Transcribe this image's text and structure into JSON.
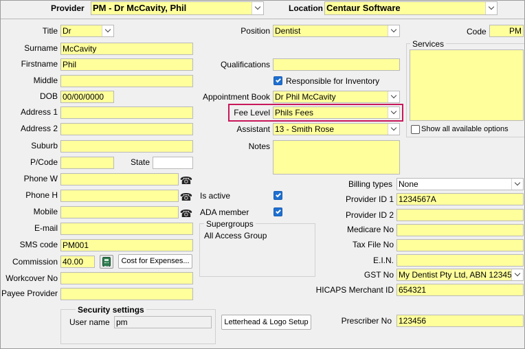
{
  "header": {
    "provider_label": "Provider",
    "provider_value": "PM - Dr McCavity, Phil",
    "location_label": "Location",
    "location_value": "Centaur Software"
  },
  "left": {
    "title_label": "Title",
    "title_value": "Dr",
    "surname_label": "Surname",
    "surname_value": "McCavity",
    "firstname_label": "Firstname",
    "firstname_value": "Phil",
    "middle_label": "Middle",
    "middle_value": "",
    "dob_label": "DOB",
    "dob_value": "00/00/0000",
    "address1_label": "Address 1",
    "address1_value": "",
    "address2_label": "Address 2",
    "address2_value": "",
    "suburb_label": "Suburb",
    "suburb_value": "",
    "pcode_label": "P/Code",
    "pcode_value": "",
    "state_label": "State",
    "state_value": "",
    "phonew_label": "Phone W",
    "phonew_value": "",
    "phoneh_label": "Phone H",
    "phoneh_value": "",
    "mobile_label": "Mobile",
    "mobile_value": "",
    "email_label": "E-mail",
    "email_value": "",
    "sms_label": "SMS code",
    "sms_value": "PM001",
    "commission_label": "Commission",
    "commission_value": "40.00",
    "cost_button": "Cost for Expenses...",
    "workcover_label": "Workcover No",
    "workcover_value": "",
    "payee_label": "Payee Provider",
    "payee_value": ""
  },
  "middle": {
    "position_label": "Position",
    "position_value": "Dentist",
    "qualifications_label": "Qualifications",
    "qualifications_value": "",
    "responsible_label": "Responsible for Inventory",
    "appt_label": "Appointment Book",
    "appt_value": "Dr Phil McCavity",
    "fee_label": "Fee Level",
    "fee_value": "Phils Fees",
    "assistant_label": "Assistant",
    "assistant_value": "13 - Smith Rose",
    "notes_label": "Notes",
    "notes_value": "",
    "isactive_label": "Is active",
    "ada_label": "ADA member",
    "supergroups_title": "Supergroups",
    "supergroups_items": [
      "All Access Group"
    ],
    "letterhead_button": "Letterhead & Logo Setup"
  },
  "right": {
    "code_label": "Code",
    "code_value": "PM",
    "services_title": "Services",
    "show_all_label": "Show all available options",
    "billing_label": "Billing types",
    "billing_value": "None",
    "pid1_label": "Provider ID 1",
    "pid1_value": "1234567A",
    "pid2_label": "Provider ID 2",
    "pid2_value": "",
    "medicare_label": "Medicare No",
    "medicare_value": "",
    "tfn_label": "Tax File No",
    "tfn_value": "",
    "ein_label": "E.I.N.",
    "ein_value": "",
    "gst_label": "GST No",
    "gst_value": "My Dentist Pty Ltd, ABN 12345",
    "hicaps_label": "HICAPS Merchant ID",
    "hicaps_value": "654321",
    "prescriber_label": "Prescriber No",
    "prescriber_value": "123456"
  },
  "security": {
    "title": "Security settings",
    "username_label": "User name",
    "username_value": "pm"
  },
  "colors": {
    "field_bg": "#ffff9c",
    "highlight": "#c8175a",
    "checkbox": "#1e6fd0"
  },
  "icons": {
    "phone": "phone-icon",
    "calculator": "calculator-icon",
    "dropdown": "chevron-down-icon",
    "check": "checkmark-icon"
  }
}
